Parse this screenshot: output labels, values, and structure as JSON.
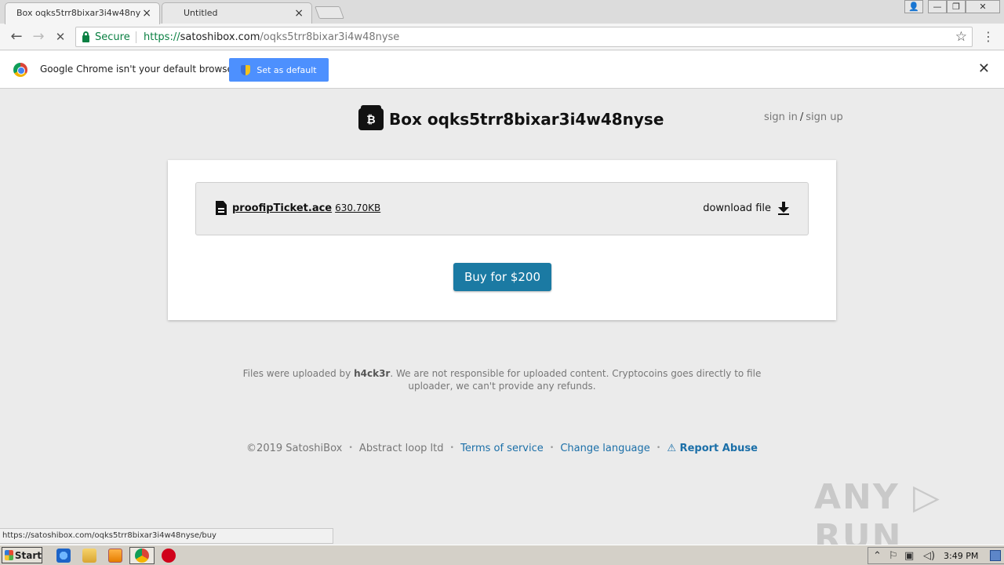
{
  "browser": {
    "tabs": [
      {
        "title": "Box oqks5trr8bixar3i4w48ny",
        "close": "×"
      },
      {
        "title": "Untitled",
        "close": "×"
      }
    ],
    "address": {
      "secure_label": "Secure",
      "scheme": "https://",
      "host": "satoshibox.com",
      "path": "/oqks5trr8bixar3i4w48nyse"
    },
    "nav": {
      "back": "←",
      "forward": "→",
      "stop": "✕",
      "star": "☆",
      "menu": "⋮"
    },
    "window": {
      "user": "👤",
      "minimize": "—",
      "restore": "❐",
      "close": "✕"
    }
  },
  "infobar": {
    "message": "Google Chrome isn't your default browser",
    "button": "Set as default",
    "close": "✕"
  },
  "page": {
    "icon_glyph": "₿",
    "title": "Box oqks5trr8bixar3i4w48nyse",
    "auth": {
      "sign_in": "sign in",
      "slash": "/",
      "sign_up": "sign up"
    },
    "file": {
      "name": "proofipTicket.ace",
      "size": "630.70KB",
      "download": "download file"
    },
    "buy_button": "Buy for $200",
    "disclaimer": {
      "prefix": "Files were uploaded by ",
      "uploader": "h4ck3r",
      "suffix": ". We are not responsible for uploaded content. Cryptocoins goes directly to file uploader, we can't provide any refunds."
    },
    "footer": {
      "copyright": "©2019 SatoshiBox",
      "company": "Abstract loop ltd",
      "terms": "Terms of service",
      "language": "Change language",
      "report": "⚠ Report Abuse",
      "sep": "•"
    }
  },
  "watermark": "ANY ▷ RUN",
  "status_url": "https://satoshibox.com/oqks5trr8bixar3i4w48nyse/buy",
  "taskbar": {
    "start": "Start",
    "clock": "3:49 PM",
    "tray_icons": [
      "chevron-up",
      "flag",
      "network",
      "volume"
    ]
  },
  "colors": {
    "accent": "#1b7aa3",
    "secure_green": "#0b8043",
    "infobar_button": "#4d90fe",
    "link": "#1b6fa8"
  }
}
